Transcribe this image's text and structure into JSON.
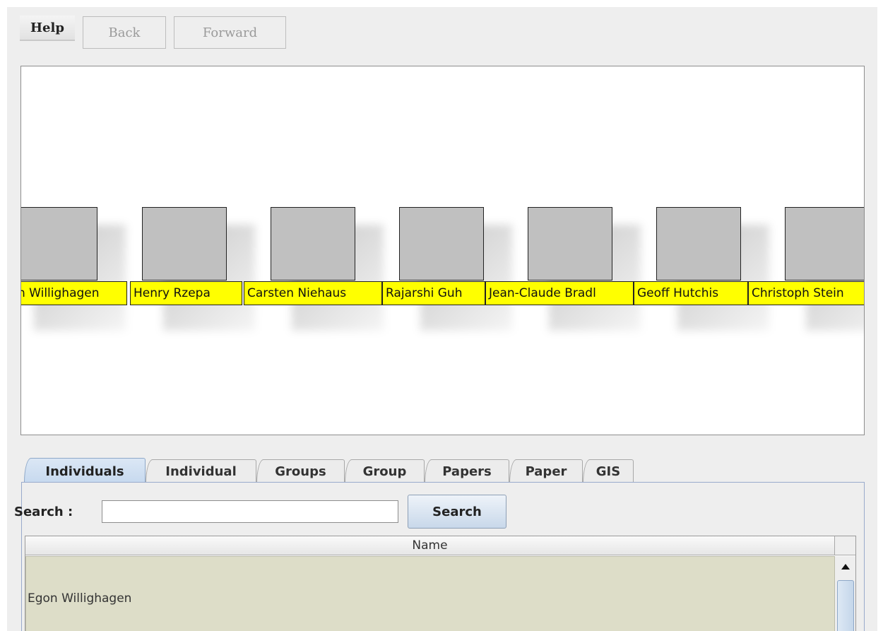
{
  "toolbar": {
    "help_label": "Help",
    "back_label": "Back",
    "forward_label": "Forward"
  },
  "graph": {
    "nodes": [
      {
        "label": "n Willighagen"
      },
      {
        "label": "Henry Rzepa"
      },
      {
        "label": "Carsten Niehaus"
      },
      {
        "label": "Rajarshi Guh"
      },
      {
        "label": "Jean-Claude Bradl"
      },
      {
        "label": "Geoff Hutchis"
      },
      {
        "label": "Christoph Stein"
      }
    ]
  },
  "tabs": [
    {
      "label": "Individuals",
      "active": true
    },
    {
      "label": "Individual",
      "active": false
    },
    {
      "label": "Groups",
      "active": false
    },
    {
      "label": "Group",
      "active": false
    },
    {
      "label": "Papers",
      "active": false
    },
    {
      "label": "Paper",
      "active": false
    },
    {
      "label": "GIS",
      "active": false
    }
  ],
  "search": {
    "label": "Search :",
    "value": "",
    "placeholder": "",
    "button_label": "Search"
  },
  "table": {
    "columns": [
      "Name"
    ],
    "rows": [
      {
        "name": "Egon Willighagen"
      }
    ]
  },
  "icons": {
    "scroll_up": "triangle-up-icon",
    "scroll_grip": "grip-icon"
  },
  "colors": {
    "node_label_bg": "#ffff00",
    "node_box": "#c0c0c0",
    "selected_row": "#ddddc8",
    "active_tab": "#c5d8ee"
  }
}
